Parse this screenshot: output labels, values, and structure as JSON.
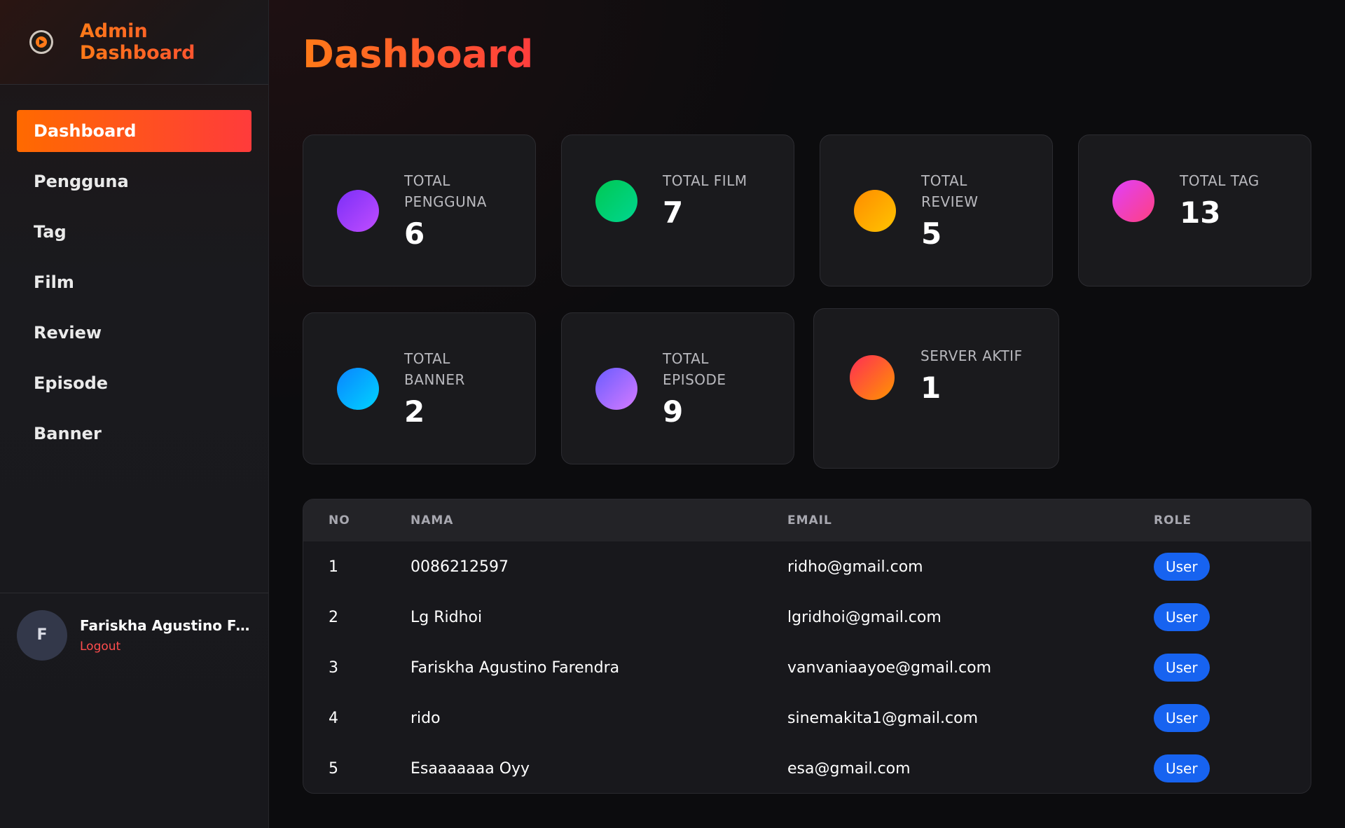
{
  "sidebar": {
    "brand_title": "Admin Dashboard",
    "brand_icon": "film-reel-icon",
    "nav": [
      {
        "label": "Dashboard",
        "active": true
      },
      {
        "label": "Pengguna",
        "active": false
      },
      {
        "label": "Tag",
        "active": false
      },
      {
        "label": "Film",
        "active": false
      },
      {
        "label": "Review",
        "active": false
      },
      {
        "label": "Episode",
        "active": false
      },
      {
        "label": "Banner",
        "active": false
      }
    ],
    "user": {
      "initial": "F",
      "name": "Fariskha Agustino Farendra",
      "logout_label": "Logout"
    }
  },
  "main": {
    "title": "Dashboard",
    "stats": [
      {
        "label": "TOTAL PENGGUNA",
        "value": "6"
      },
      {
        "label": "TOTAL FILM",
        "value": "7"
      },
      {
        "label": "TOTAL REVIEW",
        "value": "5"
      },
      {
        "label": "TOTAL TAG",
        "value": "13"
      },
      {
        "label": "TOTAL BANNER",
        "value": "2"
      },
      {
        "label": "TOTAL EPISODE",
        "value": "9"
      },
      {
        "label": "SERVER AKTIF",
        "value": "1"
      }
    ],
    "table": {
      "headers": [
        "NO",
        "NAMA",
        "EMAIL",
        "ROLE"
      ],
      "rows": [
        {
          "no": "1",
          "nama": "0086212597",
          "email": "ridho@gmail.com",
          "role": "User"
        },
        {
          "no": "2",
          "nama": "Lg Ridhoi",
          "email": "lgridhoi@gmail.com",
          "role": "User"
        },
        {
          "no": "3",
          "nama": "Fariskha Agustino Farendra",
          "email": "vanvaniaayoe@gmail.com",
          "role": "User"
        },
        {
          "no": "4",
          "nama": "rido",
          "email": "sinemakita1@gmail.com",
          "role": "User"
        },
        {
          "no": "5",
          "nama": "Esaaaaaaa Oyy",
          "email": "esa@gmail.com",
          "role": "User"
        }
      ]
    }
  },
  "colors": {
    "accent_start": "#ff6a00",
    "accent_end": "#ff3b3b",
    "badge": "#1763f0",
    "logout": "#ff4d4d"
  }
}
